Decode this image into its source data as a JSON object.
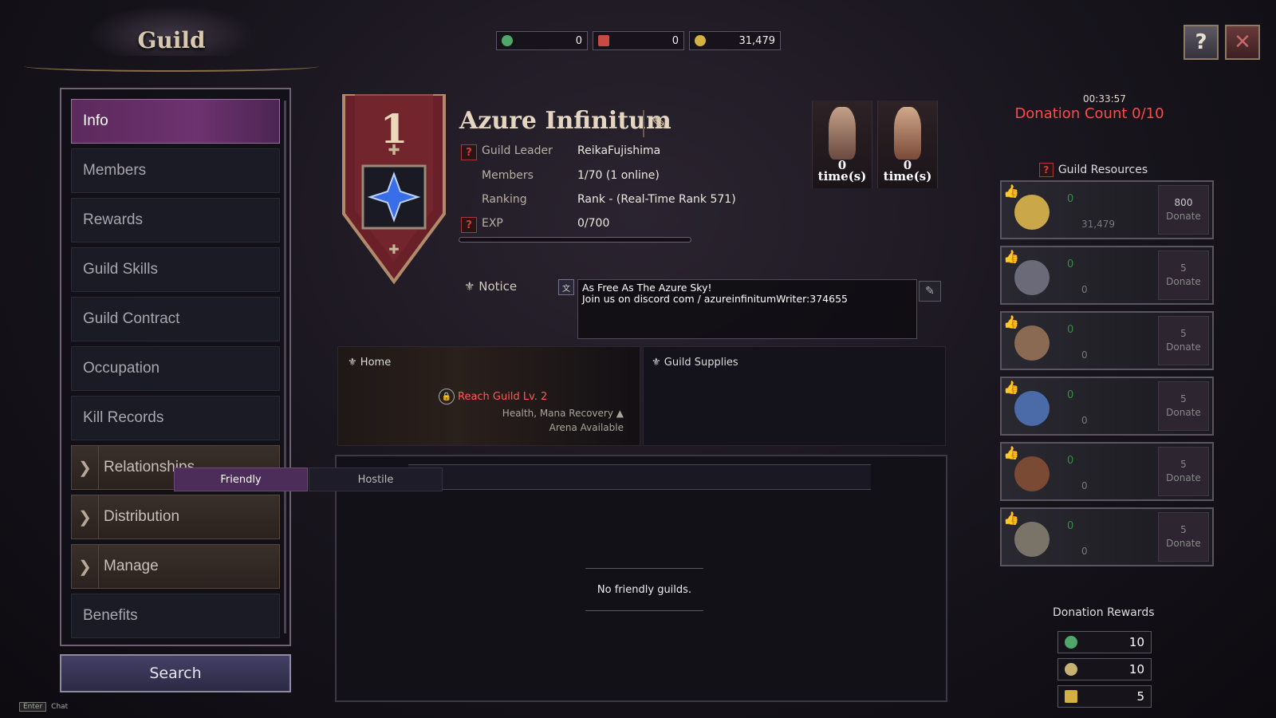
{
  "header": {
    "title": "Guild"
  },
  "currencies": [
    {
      "icon": "green-coin-icon",
      "value": "0",
      "color": "#4fa86a"
    },
    {
      "icon": "red-ticket-icon",
      "value": "0",
      "color": "#c84a42"
    },
    {
      "icon": "gold-coin-icon",
      "value": "31,479",
      "color": "#d4b040"
    }
  ],
  "menu": {
    "items": [
      {
        "label": "Info",
        "active": true
      },
      {
        "label": "Members"
      },
      {
        "label": "Rewards"
      },
      {
        "label": "Guild Skills"
      },
      {
        "label": "Guild Contract"
      },
      {
        "label": "Occupation"
      },
      {
        "label": "Kill Records"
      },
      {
        "label": "Relationships",
        "group": true
      },
      {
        "label": "Distribution",
        "group": true
      },
      {
        "label": "Manage",
        "group": true
      },
      {
        "label": "Benefits"
      }
    ],
    "search_label": "Search"
  },
  "chat_hint": {
    "key": "Enter",
    "label": "Chat"
  },
  "guild": {
    "level": "1",
    "name": "Azure Infinitum",
    "leader_label": "Guild Leader",
    "leader": "ReikaFujishima",
    "members_label": "Members",
    "members": "1/70 (1 online)",
    "ranking_label": "Ranking",
    "ranking": "Rank - (Real-Time Rank 571)",
    "exp_label": "EXP",
    "exp": "0/700",
    "exp_progress": 0
  },
  "tokens": [
    {
      "count": "0",
      "unit": "time(s)"
    },
    {
      "count": "0",
      "unit": "time(s)"
    }
  ],
  "notice": {
    "label": "Notice",
    "line1": "As Free As The Azure Sky!",
    "line2": "Join us on discord com / azureinfinitumWriter:374655"
  },
  "home": {
    "label": "Home",
    "lock_text": "Reach Guild Lv. 2",
    "desc1": "Health, Mana Recovery ▲",
    "desc2": "Arena Available"
  },
  "supplies": {
    "label": "Guild Supplies"
  },
  "relations": {
    "tabs": [
      "Friendly",
      "Hostile"
    ],
    "active_tab": "Friendly",
    "empty_message": "No friendly guilds."
  },
  "donation": {
    "timer": "00:33:57",
    "count_text": "Donation Count  0/10",
    "resources_title": "Guild Resources",
    "resources": [
      {
        "icon": "gold-coin-icon",
        "amount": "0",
        "stock": "31,479",
        "cost": "800",
        "action": "Donate",
        "color": "#caa84a"
      },
      {
        "icon": "ore-icon",
        "amount": "0",
        "stock": "0",
        "cost": "5",
        "action": "Donate",
        "color": "#6a6a78"
      },
      {
        "icon": "leather-icon",
        "amount": "0",
        "stock": "0",
        "cost": "5",
        "action": "Donate",
        "color": "#8a6a52"
      },
      {
        "icon": "crystal-icon",
        "amount": "0",
        "stock": "0",
        "cost": "5",
        "action": "Donate",
        "color": "#4a6aa8"
      },
      {
        "icon": "wood-icon",
        "amount": "0",
        "stock": "0",
        "cost": "5",
        "action": "Donate",
        "color": "#7a4a34"
      },
      {
        "icon": "mineral-icon",
        "amount": "0",
        "stock": "0",
        "cost": "5",
        "action": "Donate",
        "color": "#7a7468"
      }
    ],
    "rewards_title": "Donation Rewards",
    "rewards": [
      {
        "icon": "green-coin-icon",
        "value": "10",
        "color": "#4fa86a"
      },
      {
        "icon": "guild-emblem-icon",
        "value": "10",
        "color": "#c8b070"
      },
      {
        "icon": "trophy-icon",
        "value": "5",
        "color": "#d4b040"
      }
    ]
  }
}
